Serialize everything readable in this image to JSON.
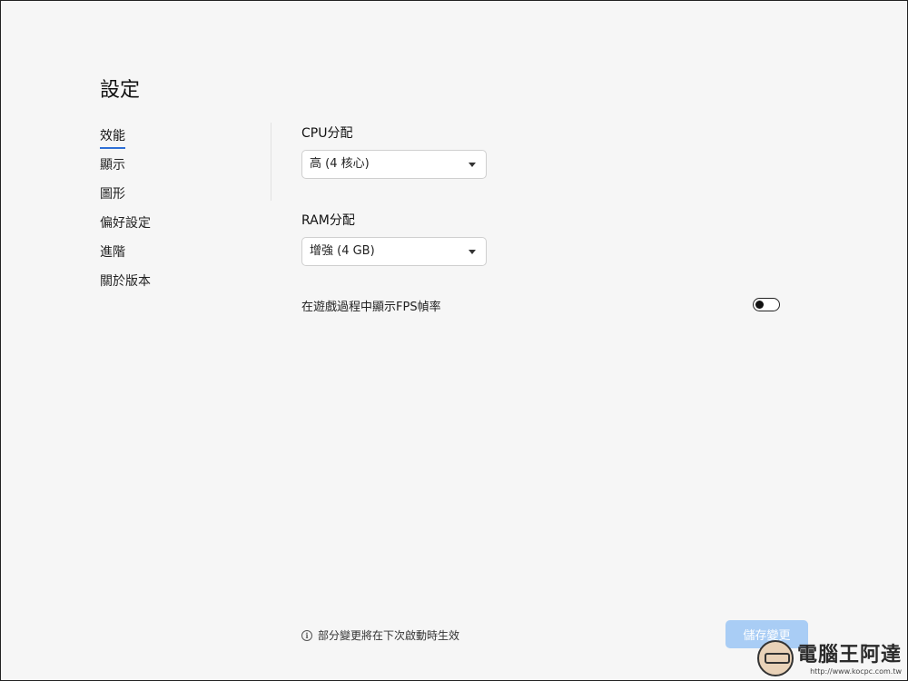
{
  "page": {
    "title": "設定"
  },
  "sidebar": {
    "items": [
      {
        "label": "效能",
        "active": true
      },
      {
        "label": "顯示",
        "active": false
      },
      {
        "label": "圖形",
        "active": false
      },
      {
        "label": "偏好設定",
        "active": false
      },
      {
        "label": "進階",
        "active": false
      },
      {
        "label": "關於版本",
        "active": false
      }
    ]
  },
  "performance": {
    "cpu": {
      "label": "CPU分配",
      "selected": "高 (4 核心)"
    },
    "ram": {
      "label": "RAM分配",
      "selected": "增強 (4 GB)"
    },
    "fps": {
      "label": "在遊戲過程中顯示FPS幀率",
      "enabled": false
    }
  },
  "footer": {
    "note": "部分變更將在下次啟動時生效",
    "save_label": "儲存變更"
  },
  "watermark": {
    "title": "電腦王阿達",
    "url": "http://www.kocpc.com.tw"
  },
  "colors": {
    "accent": "#2f6fd6",
    "save_button_disabled": "#a9cdf5",
    "background": "#f6f6f6"
  }
}
